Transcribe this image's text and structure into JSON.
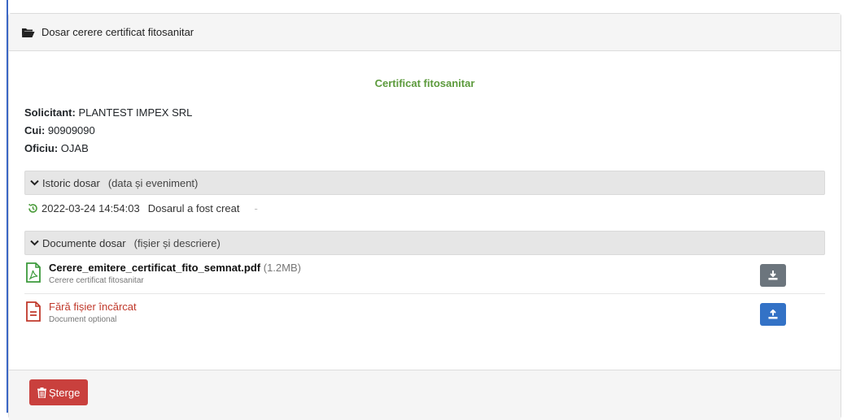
{
  "panel": {
    "title": "Dosar cerere certificat fitosanitar",
    "heading_icon": "folder-open-icon"
  },
  "certificate": {
    "title": "Certificat fitosanitar",
    "title_color": "#5c9a3c"
  },
  "applicant": {
    "solicitant_label": "Solicitant:",
    "solicitant_value": "PLANTEST IMPEX SRL",
    "cui_label": "Cui:",
    "cui_value": "90909090",
    "oficiu_label": "Oficiu:",
    "oficiu_value": "OJAB"
  },
  "history": {
    "label": "Istoric dosar",
    "sublabel": "(data și eveniment)",
    "entries": [
      {
        "timestamp": "2022-03-24 14:54:03",
        "event": "Dosarul a fost creat",
        "extra": "-"
      }
    ]
  },
  "documents": {
    "label": "Documente dosar",
    "sublabel": "(fișier și descriere)",
    "items": [
      {
        "name": "Cerere_emitere_certificat_fito_semnat.pdf",
        "size": "(1.2MB)",
        "description": "Cerere certificat fitosanitar",
        "icon": "pdf-file-icon",
        "action": "download-icon"
      },
      {
        "name": "Fără fișier încărcat",
        "description": "Document optional",
        "icon": "document-missing-icon",
        "action": "upload-icon"
      }
    ]
  },
  "footer": {
    "delete_label": "Șterge"
  },
  "colors": {
    "accent_blue": "#3372c6",
    "danger_red": "#c9403d",
    "success_green": "#5c9a3c",
    "gray_button": "#6c757d"
  }
}
